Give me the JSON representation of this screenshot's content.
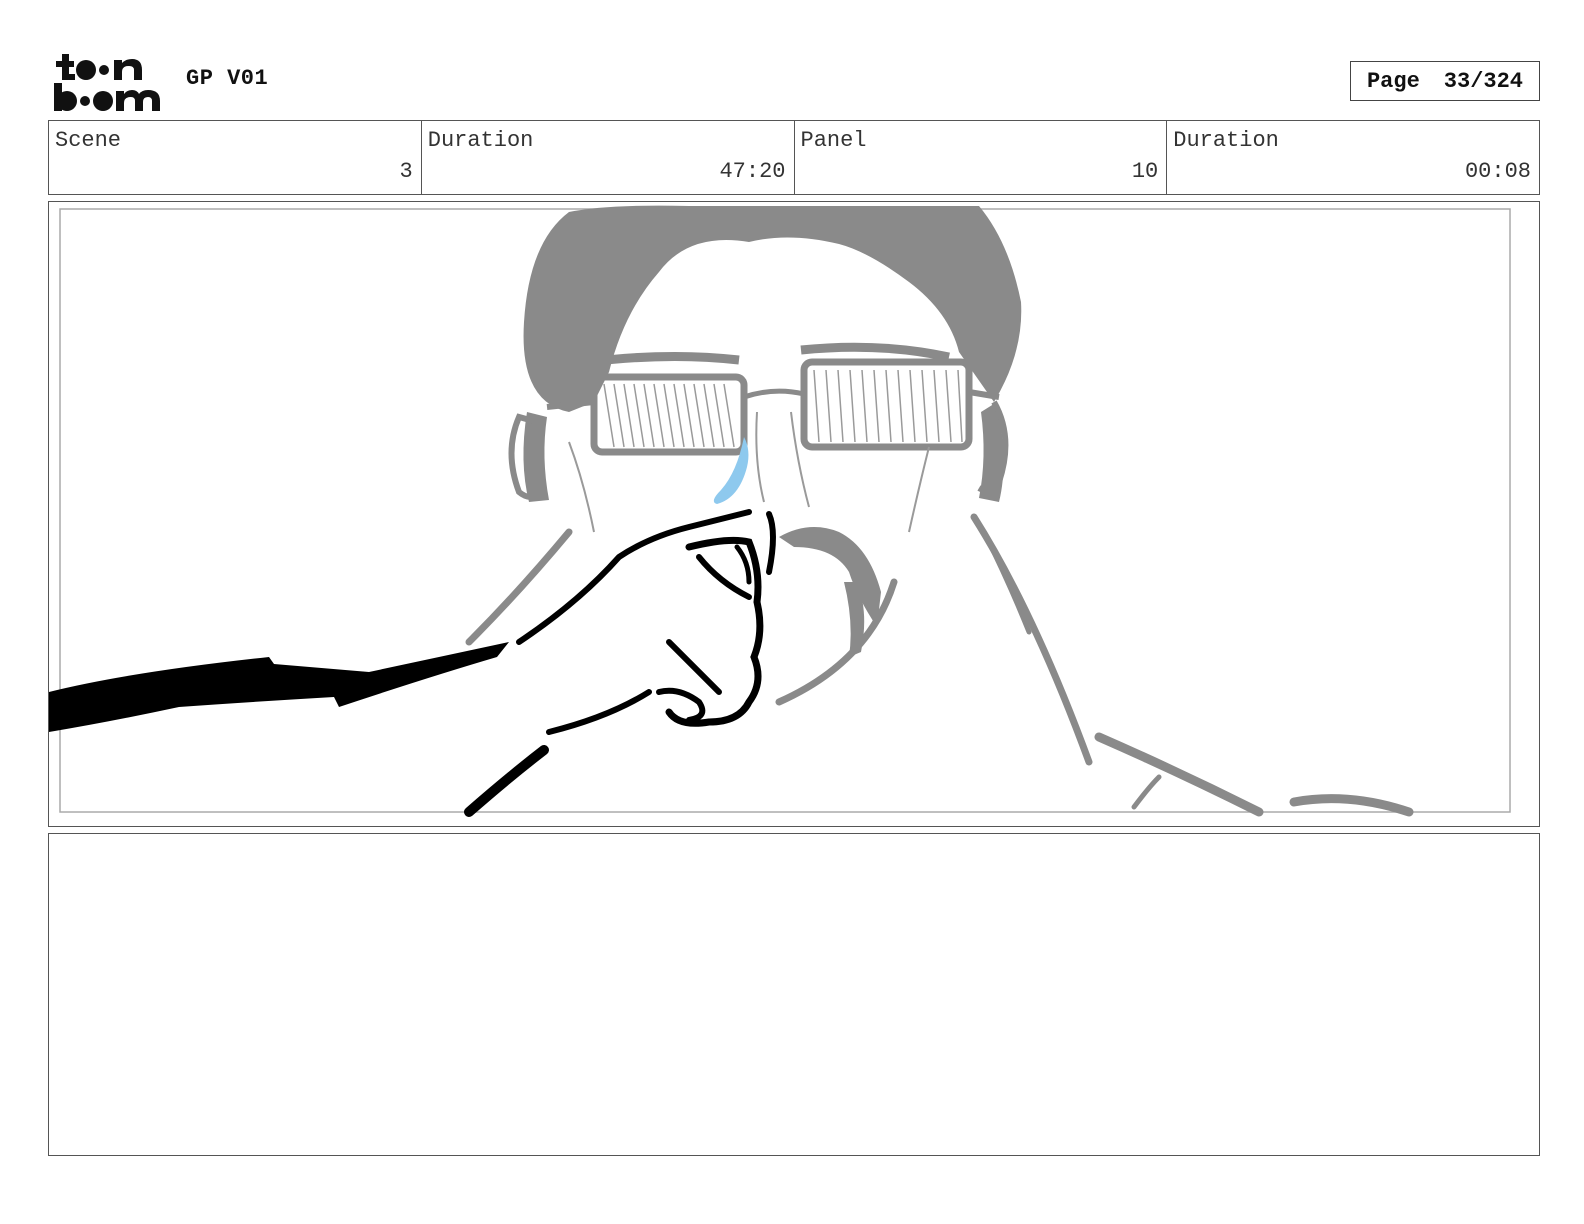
{
  "header": {
    "logo_text": "toon boom",
    "project_title": "GP V01",
    "page_label": "Page",
    "page_number": "33/324"
  },
  "info": {
    "scene_label": "Scene",
    "scene_value": "3",
    "scene_duration_label": "Duration",
    "scene_duration_value": "47:20",
    "panel_label": "Panel",
    "panel_value": "10",
    "panel_duration_label": "Duration",
    "panel_duration_value": "00:08"
  },
  "panel": {
    "description": "",
    "colors": {
      "figure": "#8a8a8a",
      "hand": "#000000",
      "tear": "#8ec9ee"
    }
  },
  "notes": {
    "text": ""
  }
}
